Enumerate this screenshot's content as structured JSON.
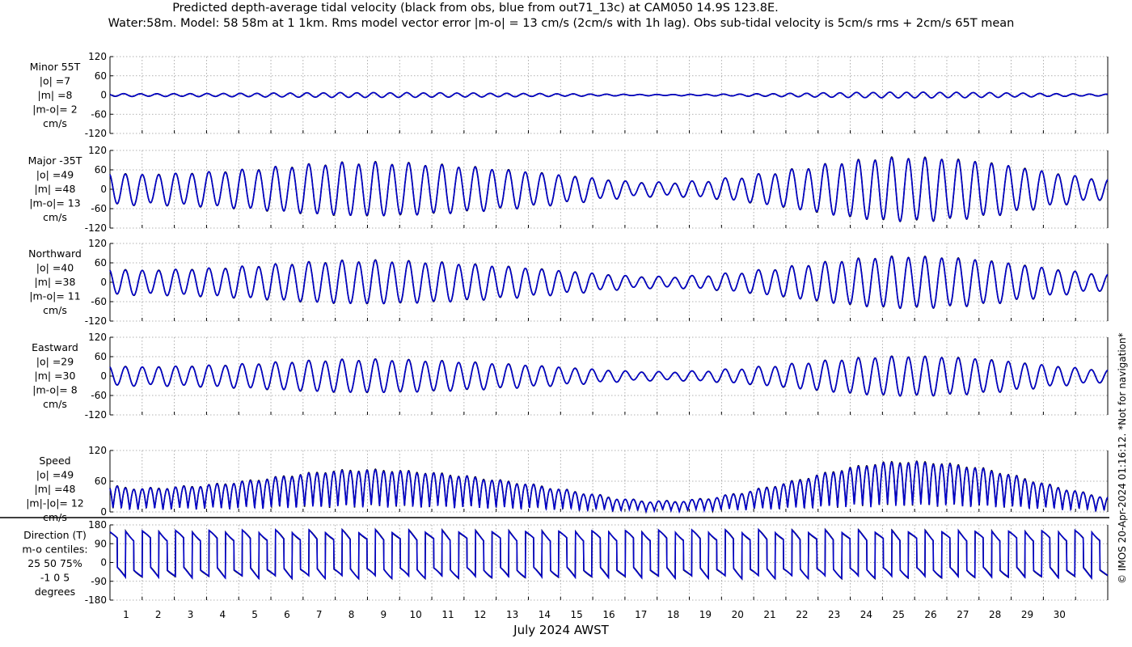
{
  "title_line1": "Predicted depth-average tidal velocity (black from obs, blue from out71_13c) at CAM050 14.9S 123.8E.",
  "title_line2": "Water:58m. Model: 58 58m at 1 1km. Rms model vector error |m-o| = 13 cm/s (2cm/s with 1h lag). Obs sub-tidal velocity is 5cm/s rms + 2cm/s 65T mean",
  "copyright": "© IMOS 20-Apr-2024 01:16:12. *Not for navigation*",
  "colors": {
    "obs": "#000000",
    "model": "#0000cc",
    "grid": "#999999",
    "axis": "#000000"
  },
  "chart_data": {
    "type": "line",
    "xlabel": "July 2024 AWST",
    "x_day_range": [
      0,
      31
    ],
    "x_tick_labels": [
      "1",
      "2",
      "3",
      "4",
      "5",
      "6",
      "7",
      "8",
      "9",
      "10",
      "11",
      "12",
      "13",
      "14",
      "15",
      "16",
      "17",
      "18",
      "19",
      "20",
      "21",
      "22",
      "23",
      "24",
      "25",
      "26",
      "27",
      "28",
      "29",
      "30"
    ],
    "day_envelope_amplitude": [
      50,
      45,
      48,
      52,
      58,
      66,
      74,
      80,
      82,
      80,
      76,
      70,
      62,
      54,
      44,
      34,
      24,
      20,
      22,
      30,
      42,
      56,
      72,
      86,
      96,
      98,
      94,
      86,
      72,
      55,
      40,
      28
    ],
    "panels": [
      {
        "id": "minor",
        "labels": [
          "Minor 55T",
          "|o| =7",
          "|m| =8",
          "|m-o|= 2",
          "cm/s"
        ],
        "ylim": [
          -120,
          120
        ],
        "yticks": [
          "120",
          "60",
          "0",
          "-60",
          "-120"
        ],
        "scale": 0.09
      },
      {
        "id": "major",
        "labels": [
          "Major -35T",
          "|o| =49",
          "|m| =48",
          "|m-o|= 13",
          "cm/s"
        ],
        "ylim": [
          -120,
          120
        ],
        "yticks": [
          "120",
          "60",
          "0",
          "-60",
          "-120"
        ],
        "scale": 1.0
      },
      {
        "id": "northward",
        "labels": [
          "Northward",
          "|o| =40",
          "|m| =38",
          "|m-o|= 11",
          "cm/s"
        ],
        "ylim": [
          -120,
          120
        ],
        "yticks": [
          "120",
          "60",
          "0",
          "-60",
          "-120"
        ],
        "scale": 0.81
      },
      {
        "id": "eastward",
        "labels": [
          "Eastward",
          "|o| =29",
          "|m| =30",
          "|m-o|= 8",
          "cm/s"
        ],
        "ylim": [
          -120,
          120
        ],
        "yticks": [
          "120",
          "60",
          "0",
          "-60",
          "-120"
        ],
        "scale": 0.62
      },
      {
        "id": "speed",
        "labels": [
          "Speed",
          "|o| =49",
          "|m| =48",
          "|m|-|o|= 12",
          "cm/s"
        ],
        "ylim": [
          0,
          120
        ],
        "yticks": [
          "120",
          "60",
          "0"
        ],
        "scale": 1.0
      },
      {
        "id": "direction",
        "labels": [
          "Direction (T)",
          "m-o centiles:",
          "25  50  75%",
          "-1  0  5",
          "degrees"
        ],
        "ylim": [
          -180,
          180
        ],
        "yticks": [
          "180",
          "90",
          "0",
          "-90",
          "-180"
        ],
        "scale": 1.0
      }
    ]
  }
}
